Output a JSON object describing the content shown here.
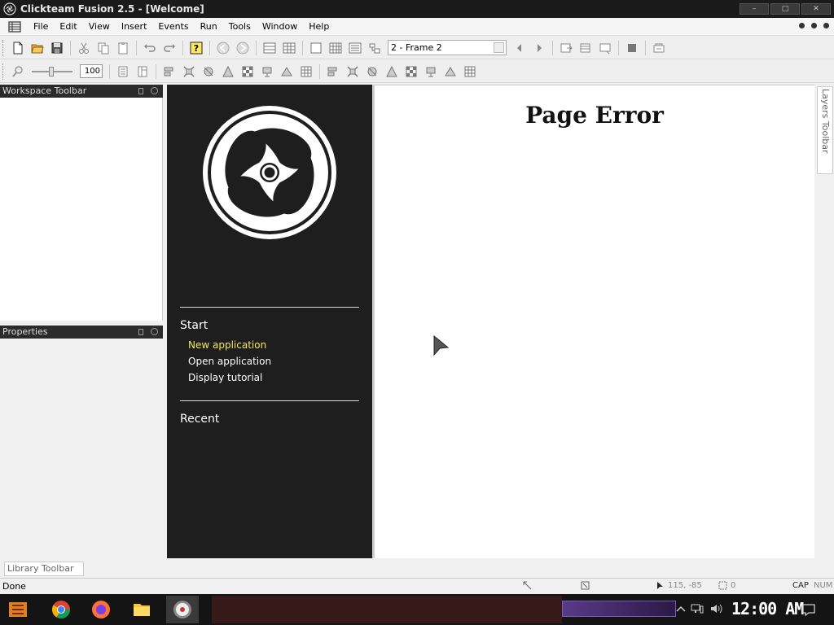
{
  "window": {
    "title": "Clickteam Fusion 2.5 - [Welcome]",
    "minimize": "–",
    "maximize": "□",
    "close": "✕"
  },
  "menu": {
    "items": [
      "File",
      "Edit",
      "View",
      "Insert",
      "Events",
      "Run",
      "Tools",
      "Window",
      "Help"
    ]
  },
  "toolbar": {
    "frame_select_value": "2 - Frame 2",
    "zoom_value": "100"
  },
  "panels": {
    "workspace_title": "Workspace Toolbar",
    "properties_title": "Properties",
    "layers_title": "Layers Toolbar",
    "library_title": "Library Toolbar"
  },
  "welcome": {
    "start_heading": "Start",
    "links": [
      "New application",
      "Open application",
      "Display tutorial"
    ],
    "recent_heading": "Recent",
    "error_title": "Page Error"
  },
  "status": {
    "text": "Done",
    "coords": "115, -85",
    "object_count": "0",
    "cap": "CAP",
    "num": "NUM"
  },
  "taskbar": {
    "clock": "12:00 AM"
  }
}
